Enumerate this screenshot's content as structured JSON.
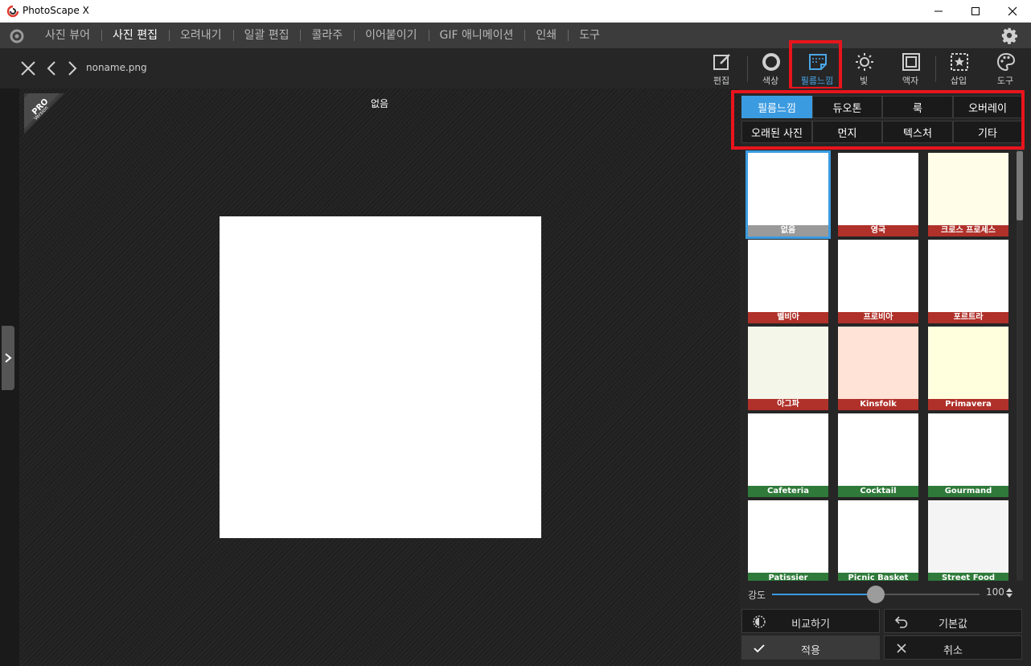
{
  "app": {
    "title": "PhotoScape X"
  },
  "menu": {
    "items": [
      "사진 뷰어",
      "사진 편집",
      "오려내기",
      "일괄 편집",
      "콜라주",
      "이어붙이기",
      "GIF 애니메이션",
      "인쇄",
      "도구"
    ],
    "active": "사진 편집"
  },
  "toolbar": {
    "filename": "noname.png",
    "tools": [
      {
        "label": "편집",
        "icon": "edit-icon"
      },
      {
        "label": "색상",
        "icon": "color-icon"
      },
      {
        "label": "필름느낌",
        "icon": "film-icon",
        "active": true
      },
      {
        "label": "빛",
        "icon": "light-icon"
      },
      {
        "label": "액자",
        "icon": "frame-icon"
      },
      {
        "label": "삽입",
        "icon": "insert-icon"
      },
      {
        "label": "도구",
        "icon": "palette-icon"
      }
    ]
  },
  "canvas": {
    "label": "없음",
    "badge": {
      "line1": "PRO",
      "line2": "Version"
    }
  },
  "categories": [
    {
      "label": "필름느낌",
      "active": true
    },
    {
      "label": "듀오톤"
    },
    {
      "label": "룩"
    },
    {
      "label": "오버레이"
    },
    {
      "label": "오래된 사진"
    },
    {
      "label": "먼지"
    },
    {
      "label": "텍스처"
    },
    {
      "label": "기타"
    }
  ],
  "filters": [
    {
      "name": "없음",
      "bg": "#ffffff",
      "label_color": "#9a9a9a",
      "selected": true
    },
    {
      "name": "영국",
      "bg": "#ffffff",
      "label_color": "#b0302a"
    },
    {
      "name": "크로스 프로세스",
      "bg": "#fffde8",
      "label_color": "#b0302a"
    },
    {
      "name": "벨비아",
      "bg": "#ffffff",
      "label_color": "#b0302a"
    },
    {
      "name": "프로비아",
      "bg": "#ffffff",
      "label_color": "#b0302a"
    },
    {
      "name": "포르트라",
      "bg": "#ffffff",
      "label_color": "#b0302a"
    },
    {
      "name": "아그파",
      "bg": "#f4f6ea",
      "label_color": "#b0302a"
    },
    {
      "name": "Kinsfolk",
      "bg": "#ffe3d6",
      "label_color": "#b0302a"
    },
    {
      "name": "Primavera",
      "bg": "#ffffde",
      "label_color": "#b0302a"
    },
    {
      "name": "Cafeteria",
      "bg": "#ffffff",
      "label_color": "#2f7a3a"
    },
    {
      "name": "Cocktail",
      "bg": "#ffffff",
      "label_color": "#2f7a3a"
    },
    {
      "name": "Gourmand",
      "bg": "#ffffff",
      "label_color": "#2f7a3a"
    },
    {
      "name": "Patissier",
      "bg": "#ffffff",
      "label_color": "#2f7a3a"
    },
    {
      "name": "Picnic Basket",
      "bg": "#ffffff",
      "label_color": "#2f7a3a"
    },
    {
      "name": "Street Food",
      "bg": "#f4f4f4",
      "label_color": "#2f7a3a"
    }
  ],
  "strength": {
    "label": "강도",
    "value": "100",
    "fraction": 0.5
  },
  "buttons": {
    "compare": "비교하기",
    "reset": "기본값",
    "apply": "적용",
    "cancel": "취소"
  },
  "colors": {
    "accent": "#3b9be0",
    "highlight": "#e8141c"
  }
}
